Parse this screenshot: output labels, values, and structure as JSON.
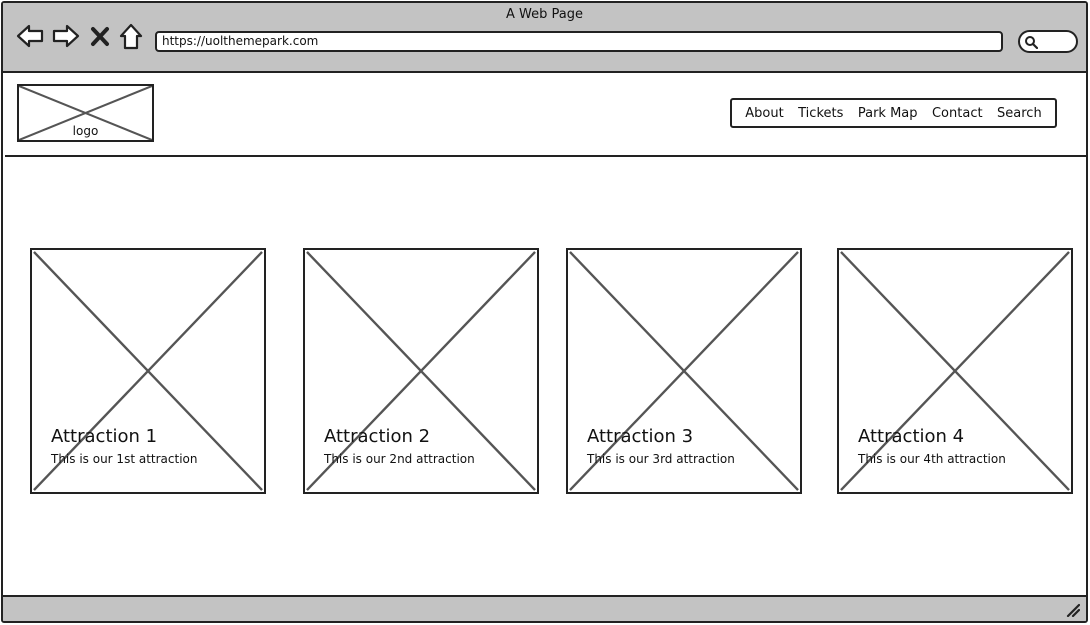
{
  "window": {
    "title": "A Web Page"
  },
  "browser": {
    "url": "https://uolthemepark.com",
    "icons": [
      "back-arrow-icon",
      "forward-arrow-icon",
      "close-x-icon",
      "home-icon",
      "search-icon"
    ]
  },
  "header": {
    "logo_label": "logo",
    "nav": [
      "About",
      "Tickets",
      "Park Map",
      "Contact",
      "Search"
    ]
  },
  "attractions": [
    {
      "title": "Attraction 1",
      "description": "This is our 1st attraction"
    },
    {
      "title": "Attraction 2",
      "description": "This is our 2nd attraction"
    },
    {
      "title": "Attraction 3",
      "description": "This is our 3rd attraction"
    },
    {
      "title": "Attraction 4",
      "description": "This is our 4th attraction"
    }
  ],
  "colors": {
    "chrome": "#c3c3c3",
    "stroke": "#222222",
    "placeholder_x": "#555555"
  }
}
